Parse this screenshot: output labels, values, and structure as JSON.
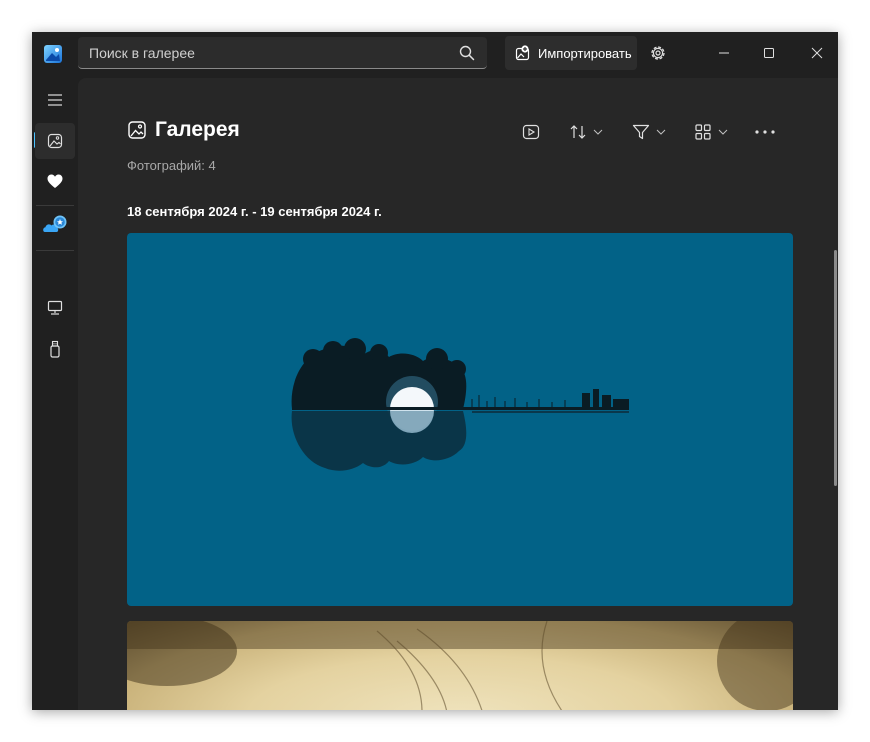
{
  "search": {
    "placeholder": "Поиск в галерее"
  },
  "toolbar": {
    "import_label": "Импортировать"
  },
  "gallery": {
    "title": "Галерея",
    "photo_count": "Фотографий: 4",
    "date_range": "18 сентября 2024 г. - 19 сентября 2024 г."
  },
  "sidebar": {
    "items": [
      {
        "name": "menu",
        "icon": "hamburger-icon"
      },
      {
        "name": "gallery",
        "icon": "gallery-icon",
        "active": true
      },
      {
        "name": "favorites",
        "icon": "heart-icon"
      },
      {
        "name": "onedrive",
        "icon": "onedrive-icon"
      },
      {
        "name": "this-pc",
        "icon": "computer-icon"
      },
      {
        "name": "usb-drive",
        "icon": "usb-icon"
      }
    ]
  },
  "colors": {
    "accent": "#4cc2ff",
    "window_bg": "#202020",
    "content_bg": "#272727",
    "photo1_bg": "#026287"
  }
}
